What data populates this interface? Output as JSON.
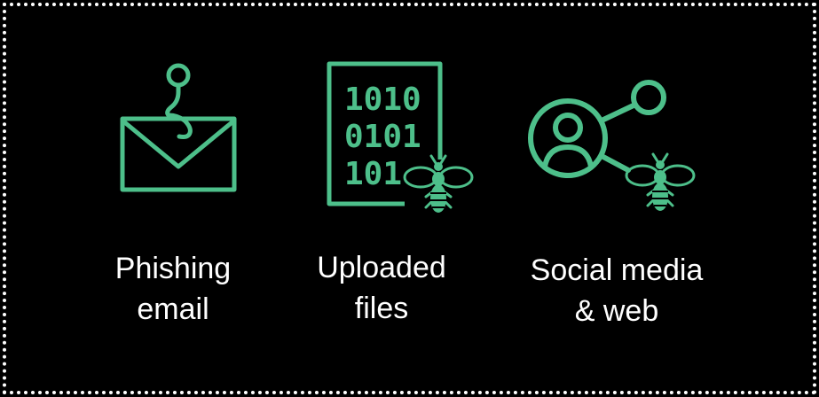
{
  "colors": {
    "background": "#000000",
    "border": "#ffffff",
    "icon_accent": "#4dbf8a",
    "text": "#ffffff"
  },
  "items": [
    {
      "icon": "phishing-email-icon",
      "label_line1": "Phishing",
      "label_line2": "email"
    },
    {
      "icon": "binary-file-bug-icon",
      "label_line1": "Uploaded",
      "label_line2": "files",
      "binary_rows": [
        "1010",
        "0101",
        "101"
      ]
    },
    {
      "icon": "social-share-bug-icon",
      "label_line1": "Social media",
      "label_line2": "& web"
    }
  ]
}
